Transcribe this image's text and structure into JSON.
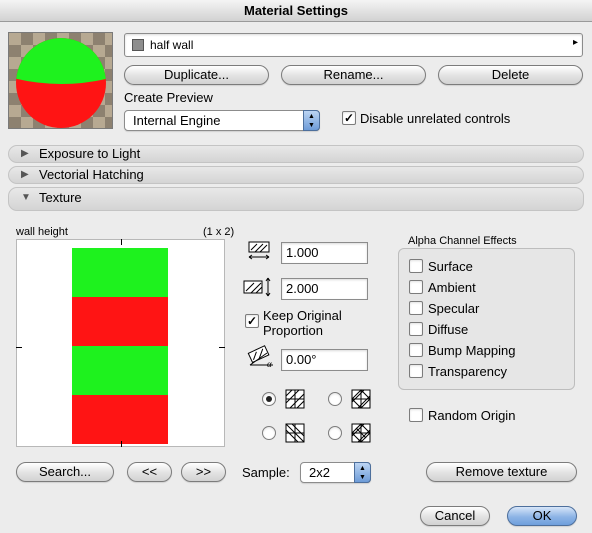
{
  "window": {
    "title": "Material Settings"
  },
  "colors": {
    "green": "#1ef21e",
    "red": "#ff1414",
    "accent": "#6f9fdc"
  },
  "material": {
    "name": "half wall"
  },
  "buttons": {
    "duplicate": "Duplicate...",
    "rename": "Rename...",
    "delete": "Delete",
    "search": "Search...",
    "prev": "<<",
    "next": ">>",
    "remove_texture": "Remove texture",
    "cancel": "Cancel",
    "ok": "OK"
  },
  "preview": {
    "label": "Create Preview",
    "engine": "Internal Engine",
    "disable_unrelated_label": "Disable unrelated controls",
    "disable_unrelated_checked": true
  },
  "sections": [
    {
      "label": "Exposure to Light",
      "expanded": false
    },
    {
      "label": "Vectorial Hatching",
      "expanded": false
    },
    {
      "label": "Texture",
      "expanded": true
    }
  ],
  "texture": {
    "name_label": "wall height",
    "grid_label": "(1 x 2)",
    "width": "1.000",
    "height": "2.000",
    "keep_proportion_label": "Keep Original Proportion",
    "keep_proportion_checked": true,
    "angle": "0.00°",
    "sample_label": "Sample:",
    "sample_value": "2x2",
    "orientations": [
      {
        "icon": "texture-orientation-1-icon",
        "selected": true
      },
      {
        "icon": "texture-orientation-2-icon",
        "selected": false
      },
      {
        "icon": "texture-orientation-3-icon",
        "selected": false
      },
      {
        "icon": "texture-orientation-4-icon",
        "selected": false
      }
    ]
  },
  "alpha": {
    "title": "Alpha Channel Effects",
    "effects": [
      {
        "label": "Surface",
        "checked": false
      },
      {
        "label": "Ambient",
        "checked": false
      },
      {
        "label": "Specular",
        "checked": false
      },
      {
        "label": "Diffuse",
        "checked": false
      },
      {
        "label": "Bump Mapping",
        "checked": false
      },
      {
        "label": "Transparency",
        "checked": false
      }
    ],
    "random_origin_label": "Random Origin",
    "random_origin_checked": false
  }
}
